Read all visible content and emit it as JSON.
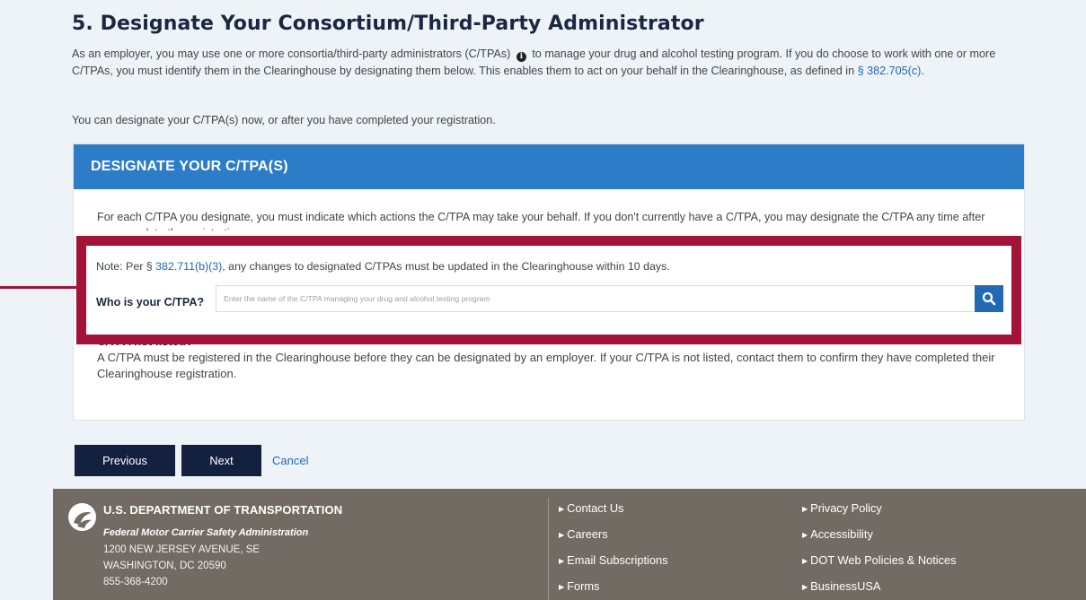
{
  "section": {
    "title": "5. Designate Your Consortium/Third-Party Administrator",
    "intro_part1": "As an employer, you may use one or more consortia/third-party administrators (C/TPAs)",
    "intro_part2": "to manage your drug and alcohol testing program. If you do choose to work with one or more C/TPAs, you must identify them in the Clearinghouse by designating them below. This enables them to act on your behalf in the Clearinghouse, as defined in",
    "intro_link": "§ 382.705(c)",
    "intro_end": ".",
    "later_text": "You can designate your C/TPA(s) now, or after you have completed your registration."
  },
  "card": {
    "header": "DESIGNATE YOUR C/TPA(S)",
    "description": "For each C/TPA you designate, you must indicate which actions the C/TPA may take your behalf. If you don't currently have a C/TPA, you may designate the C/TPA any time after you complete the registration.",
    "note_prefix": "Note: Per §",
    "note_link": "382.711(b)(3)",
    "note_suffix": ", any changes to designated C/TPAs must be updated in the Clearinghouse within 10 days.",
    "who_label": "Who is your C/TPA?",
    "search_placeholder": "Enter the name of the C/TPA managing your drug and alcohol testing program",
    "not_listed_title": "C/TPA not listed?",
    "not_listed_text": "A C/TPA must be registered in the Clearinghouse before they can be designated by an employer. If your C/TPA is not listed, contact them to confirm they have completed their Clearinghouse registration."
  },
  "actions": {
    "previous": "Previous",
    "next": "Next",
    "cancel": "Cancel"
  },
  "footer": {
    "agency": "U.S. DEPARTMENT OF TRANSPORTATION",
    "administration": "Federal Motor Carrier Safety Administration",
    "address_line1": "1200 NEW JERSEY AVENUE, SE",
    "address_line2": "WASHINGTON, DC 20590",
    "phone": "855-368-4200",
    "links_col1": [
      "Contact Us",
      "Careers",
      "Email Subscriptions",
      "Forms"
    ],
    "links_col2": [
      "Privacy Policy",
      "Accessibility",
      "DOT Web Policies & Notices",
      "BusinessUSA"
    ]
  },
  "colors": {
    "highlight_border": "#a31337",
    "card_header": "#2d7cc8",
    "button_dark": "#14203f",
    "footer_bg": "#726b63",
    "link": "#2168b5"
  },
  "icons": {
    "info": "info-icon",
    "search": "search-icon",
    "logo": "dot-logo-icon",
    "link_marker": "triangle-right-icon"
  }
}
